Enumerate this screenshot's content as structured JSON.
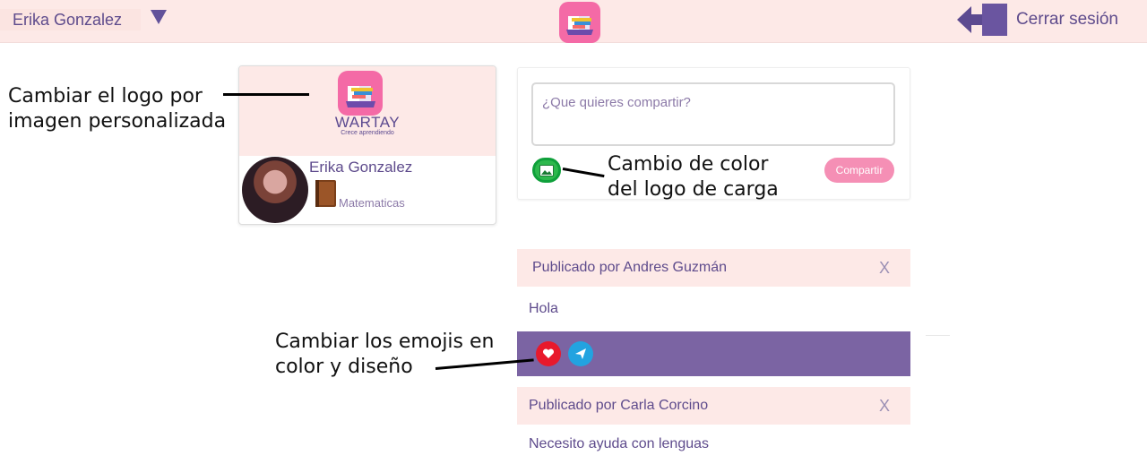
{
  "header": {
    "user_name": "Erika Gonzalez",
    "logout_label": "Cerrar sesión"
  },
  "profile": {
    "brand_name": "WARTAY",
    "brand_tagline": "Crece aprendiendo",
    "name": "Erika Gonzalez",
    "subject": "Matematicas"
  },
  "share": {
    "placeholder": "¿Que quieres compartir?",
    "share_label": "Compartir"
  },
  "posts": [
    {
      "author": "Publicado por Andres Guzmán",
      "close": "X",
      "text": "Hola"
    },
    {
      "author": "Publicado por Carla Corcino",
      "close": "X",
      "text": "Necesito ayuda con lenguas"
    }
  ],
  "annotations": {
    "logo_note": [
      "Cambiar el logo por",
      "imagen personalizada"
    ],
    "upload_note": [
      "Cambio de color",
      "del logo de carga"
    ],
    "emoji_note": [
      "Cambiar los emojis en",
      "color y diseño"
    ]
  },
  "colors": {
    "brand_purple": "#5e4b8c",
    "topbar_pink": "#fde9e7",
    "accent_pink": "#f58fb5",
    "upload_green": "#2db84d",
    "heart_red": "#e8192c",
    "send_blue": "#22a3e0",
    "action_bar": "#7b64a3"
  }
}
